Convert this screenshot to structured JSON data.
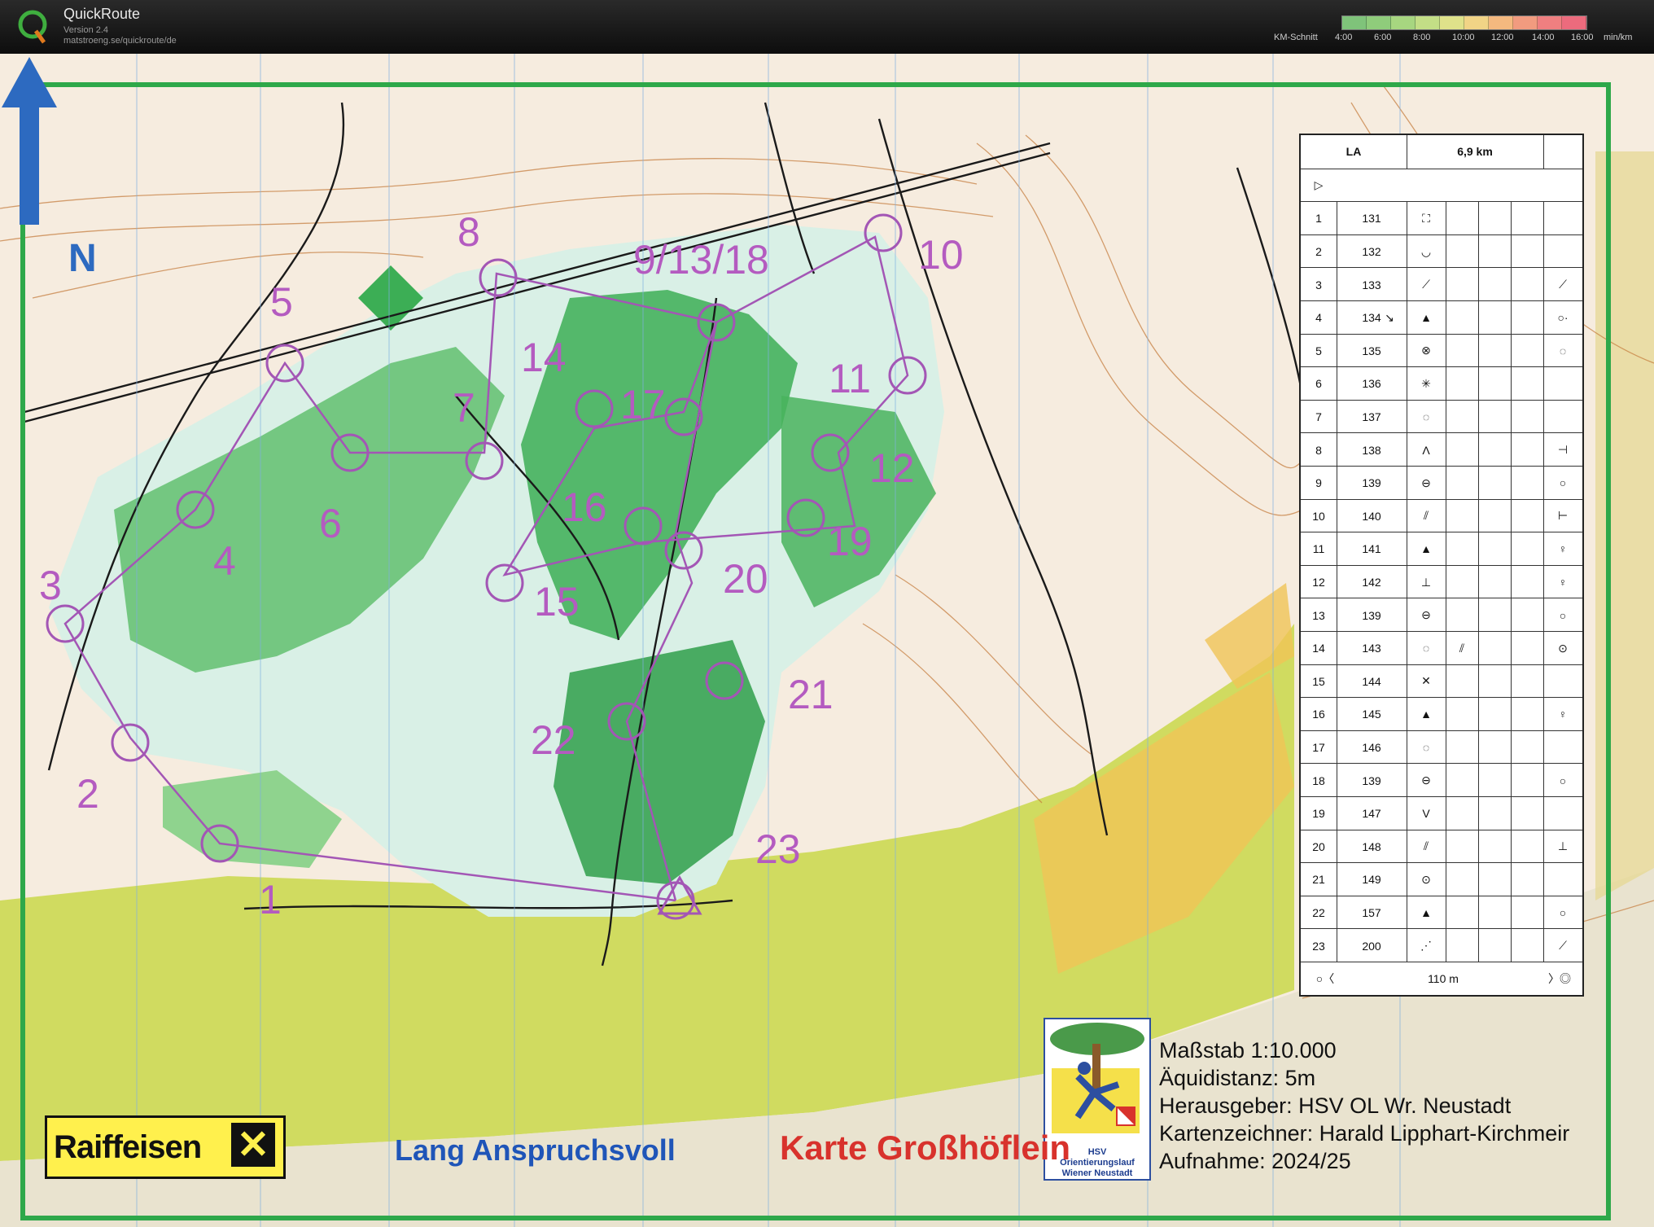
{
  "app": {
    "name": "QuickRoute",
    "version": "Version 2.4",
    "url": "matstroeng.se/quickroute/de",
    "pace_label": "KM-Schnitt",
    "pace_unit": "min/km",
    "pace_ticks": [
      "4:00",
      "6:00",
      "8:00",
      "10:00",
      "12:00",
      "14:00",
      "16:00"
    ],
    "pace_colors": [
      "#7fc37a",
      "#8fcc7b",
      "#a7d680",
      "#c3de86",
      "#dfe28a",
      "#f1d486",
      "#f4b97f",
      "#f19b7f",
      "#ef7f80",
      "#ec6b7d"
    ]
  },
  "map": {
    "north_label": "N",
    "course_name": "Lang Anspruchsvoll",
    "map_name": "Karte Großhöflein",
    "sponsor": "Raiffeisen",
    "club_logo_text": "HSV",
    "club_logo_caption": [
      "Orientierungslauf",
      "Wiener Neustadt"
    ],
    "info_lines": [
      "Maßstab 1:10.000",
      "Äquidistanz: 5m",
      "Herausgeber: HSV OL Wr. Neustadt",
      "Kartenzeichner: Harald Lipphart-Kirchmeir",
      "Aufnahme: 2024/25"
    ],
    "control_labels": [
      "1",
      "2",
      "3",
      "4",
      "5",
      "6",
      "7",
      "8",
      "9/13/18",
      "10",
      "11",
      "12",
      "14",
      "15",
      "16",
      "17",
      "19",
      "20",
      "21",
      "22",
      "23"
    ]
  },
  "description_sheet": {
    "class": "LA",
    "distance": "6,9 km",
    "rows": [
      {
        "n": "1",
        "code": "131",
        "sym": "⛶",
        "extra": ""
      },
      {
        "n": "2",
        "code": "132",
        "sym": "◡",
        "extra": ""
      },
      {
        "n": "3",
        "code": "133",
        "sym": "⟋",
        "extra": "⟋"
      },
      {
        "n": "4",
        "code": "134",
        "sym": "▲",
        "extra": "○·",
        "dir": "↘"
      },
      {
        "n": "5",
        "code": "135",
        "sym": "⊗",
        "extra": "◌"
      },
      {
        "n": "6",
        "code": "136",
        "sym": "✳",
        "extra": ""
      },
      {
        "n": "7",
        "code": "137",
        "sym": "◌",
        "extra": ""
      },
      {
        "n": "8",
        "code": "138",
        "sym": "Λ",
        "extra": "⊣"
      },
      {
        "n": "9",
        "code": "139",
        "sym": "⊖",
        "extra": "○"
      },
      {
        "n": "10",
        "code": "140",
        "sym": "⫽",
        "extra": "⊢"
      },
      {
        "n": "11",
        "code": "141",
        "sym": "▲",
        "extra": "♀"
      },
      {
        "n": "12",
        "code": "142",
        "sym": "⊥",
        "extra": "♀"
      },
      {
        "n": "13",
        "code": "139",
        "sym": "⊖",
        "extra": "○"
      },
      {
        "n": "14",
        "code": "143",
        "sym": "◌",
        "extra": "⊙",
        "extra2": "⫽"
      },
      {
        "n": "15",
        "code": "144",
        "sym": "✕",
        "extra": ""
      },
      {
        "n": "16",
        "code": "145",
        "sym": "▲",
        "extra": "♀"
      },
      {
        "n": "17",
        "code": "146",
        "sym": "◌",
        "extra": ""
      },
      {
        "n": "18",
        "code": "139",
        "sym": "⊖",
        "extra": "○"
      },
      {
        "n": "19",
        "code": "147",
        "sym": "V",
        "extra": ""
      },
      {
        "n": "20",
        "code": "148",
        "sym": "⫽",
        "extra": "⊥"
      },
      {
        "n": "21",
        "code": "149",
        "sym": "⊙",
        "extra": ""
      },
      {
        "n": "22",
        "code": "157",
        "sym": "▲",
        "extra": "○"
      },
      {
        "n": "23",
        "code": "200",
        "sym": "⋰",
        "extra": "⟋"
      }
    ],
    "finish": "110 m"
  }
}
